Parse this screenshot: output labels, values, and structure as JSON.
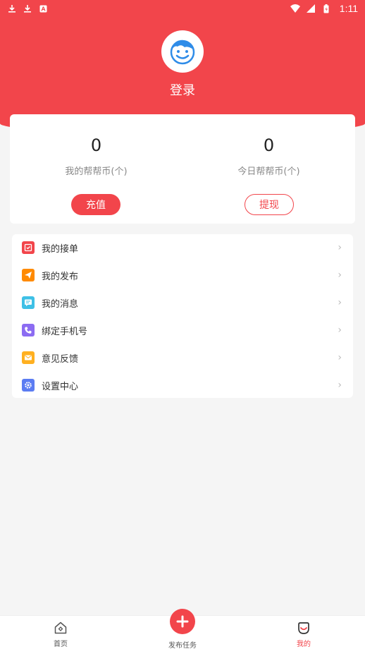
{
  "status_bar": {
    "time": "1:11",
    "left_icons": [
      "download-icon",
      "download-icon",
      "app-notification-icon"
    ],
    "right_icons": [
      "wifi-icon",
      "signal-icon",
      "battery-icon"
    ]
  },
  "profile": {
    "avatar_icon": "smiley-face-avatar-icon",
    "login_label": "登录"
  },
  "wallet": {
    "my_coins": {
      "value": "0",
      "label": "我的帮帮币(个)"
    },
    "today_coins": {
      "value": "0",
      "label": "今日帮帮币(个)"
    },
    "recharge_label": "充值",
    "withdraw_label": "提现"
  },
  "menu": {
    "items": [
      {
        "label": "我的接单",
        "icon": "order-icon",
        "color": "#f2454b"
      },
      {
        "label": "我的发布",
        "icon": "send-icon",
        "color": "#ff8a00"
      },
      {
        "label": "我的消息",
        "icon": "message-icon",
        "color": "#3ec0e6"
      },
      {
        "label": "绑定手机号",
        "icon": "phone-icon",
        "color": "#8c6cf2"
      },
      {
        "label": "意见反馈",
        "icon": "mail-icon",
        "color": "#ffb020"
      },
      {
        "label": "设置中心",
        "icon": "settings-icon",
        "color": "#5b7cf2"
      }
    ]
  },
  "bottom_nav": {
    "home_label": "首页",
    "publish_label": "发布任务",
    "me_label": "我的",
    "active": "我的"
  },
  "colors": {
    "brand": "#f2454b",
    "background": "#f5f5f5"
  }
}
